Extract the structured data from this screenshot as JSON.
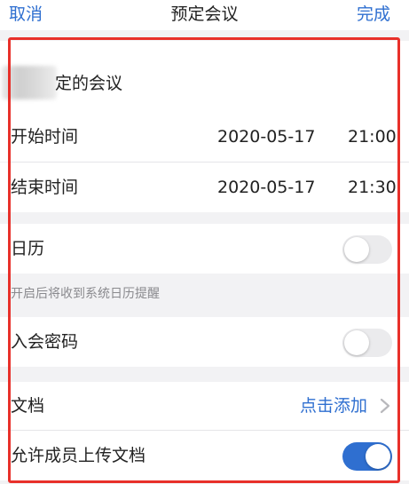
{
  "topbar": {
    "cancel_label": "取消",
    "title": "预定会议",
    "done_label": "完成"
  },
  "topic": {
    "label": "定的会议"
  },
  "start_time": {
    "label": "开始时间",
    "date": "2020-05-17",
    "time": "21:00"
  },
  "end_time": {
    "label": "结束时间",
    "date": "2020-05-17",
    "time": "21:30"
  },
  "calendar": {
    "label": "日历",
    "enabled": false,
    "hint": "开启后将收到系统日历提醒"
  },
  "password": {
    "label": "入会密码",
    "enabled": false
  },
  "documents": {
    "label": "文档",
    "add_label": "点击添加"
  },
  "member_upload": {
    "label": "允许成员上传文档",
    "enabled": true
  },
  "colors": {
    "accent": "#2f6fd0",
    "highlight_frame": "#e8302a",
    "background": "#f2f2f4"
  }
}
